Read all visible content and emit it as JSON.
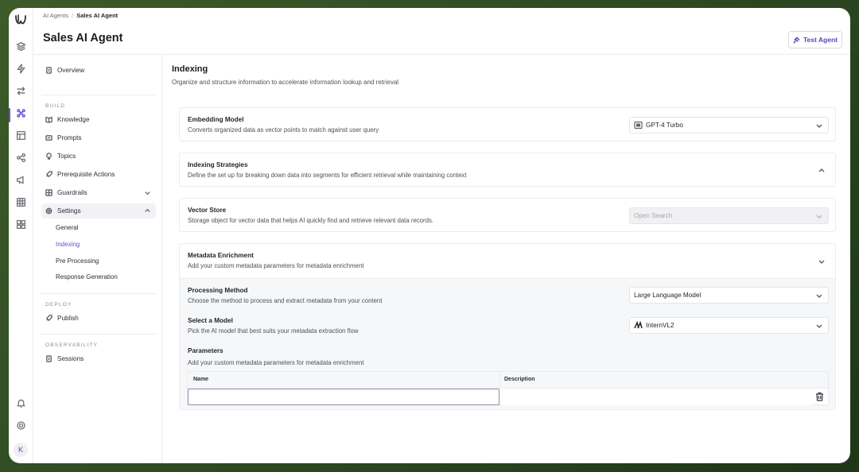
{
  "breadcrumb": {
    "parent": "AI Agents",
    "separator": "/",
    "current": "Sales AI Agent"
  },
  "header": {
    "title": "Sales AI Agent",
    "test_button": "Test Agent"
  },
  "nav": {
    "overview": "Overview",
    "build_label": "BUILD",
    "knowledge": "Knowledge",
    "prompts": "Prompts",
    "topics": "Topics",
    "prerequisite_actions": "Prerequisite Actions",
    "guardrails": "Guardrails",
    "settings": "Settings",
    "settings_sub": [
      "General",
      "Indexing",
      "Pre Processing",
      "Response Generation"
    ],
    "deploy_label": "DEPLOY",
    "publish": "Publish",
    "observability_label": "OBSERVABILITY",
    "sessions": "Sessions"
  },
  "user": {
    "initial": "K"
  },
  "main": {
    "title": "Indexing",
    "subtitle": "Organize and structure information to accelerate information lookup and retrieval"
  },
  "embedding": {
    "title": "Embedding Model",
    "desc": "Converts organized data as vector points to match against user query",
    "value": "GPT-4 Turbo"
  },
  "strategies": {
    "title": "Indexing Strategies",
    "desc": "Define the set up for breaking down data into segments for efficient retrieval while maintaining context"
  },
  "vector_store": {
    "title": "Vector Store",
    "desc": "Storage object for vector data that helps AI quickly find and retrieve relevant data records.",
    "value": "Open Search"
  },
  "enrichment": {
    "title": "Metadata Enrichment",
    "desc": "Add your custom metadata parameters for metadata enrichment",
    "processing": {
      "title": "Processing Method",
      "desc": "Choose the method to process and extract metadata from your content",
      "value": "Large Language Model"
    },
    "model": {
      "title": "Select a Model",
      "desc": "Pick the AI model that best suits your metadata extraction flow",
      "value": "InternVL2"
    },
    "parameters": {
      "title": "Parameters",
      "desc": "Add your custom metadata parameters for metadata enrichment",
      "col_name": "Name",
      "col_description": "Description",
      "name_value": "",
      "description_value": ""
    }
  },
  "colors": {
    "accent": "#6d48d8",
    "background": "#2e4a22"
  }
}
